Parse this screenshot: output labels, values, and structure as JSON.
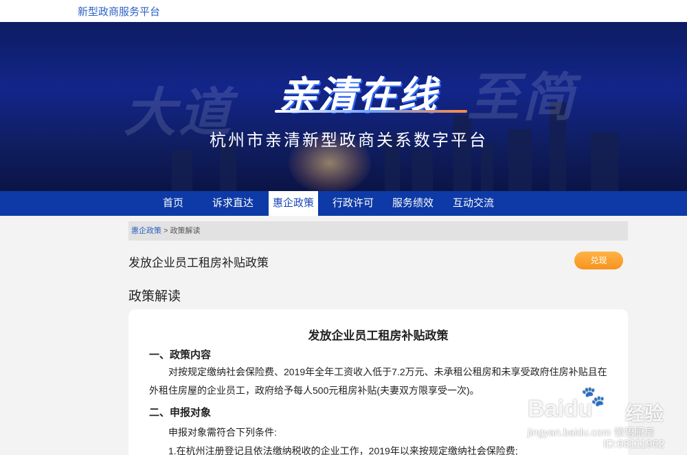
{
  "site": {
    "name": "新型政商服务平台"
  },
  "banner": {
    "ghost_left": "大道",
    "ghost_right": "至简",
    "logo": "亲清在线",
    "subtitle": "杭州市亲清新型政商关系数字平台"
  },
  "nav": {
    "items": [
      {
        "label": "首页"
      },
      {
        "label": "诉求直达"
      },
      {
        "label": "惠企政策"
      },
      {
        "label": "行政许可"
      },
      {
        "label": "服务绩效"
      },
      {
        "label": "互动交流"
      }
    ],
    "active_index": 2
  },
  "breadcrumb": {
    "link": "惠企政策",
    "separator": ">",
    "current": "政策解读"
  },
  "policy": {
    "title": "发放企业员工租房补贴政策",
    "redeem_button": "兑现"
  },
  "section": {
    "title": "政策解读"
  },
  "document": {
    "title": "发放企业员工租房补贴政策",
    "h1": "一、政策内容",
    "p1": "对按规定缴纳社会保险费、2019年全年工资收入低于7.2万元、未承租公租房和未享受政府住房补贴且在外租住房屋的企业员工，政府给予每人500元租房补贴(夫妻双方限享受一次)。",
    "h2": "二、申报对象",
    "p2": "申报对象需符合下列条件:",
    "p3": "1.在杭州注册登记且依法缴纳税收的企业工作，2019年以来按规定缴纳社会保险费;"
  },
  "watermark": {
    "brand": "Bai",
    "du": "du",
    "jingyan": "经验",
    "url": "jingyan.baidu.com",
    "author": "领悟厨房",
    "id": "ID:68111962"
  },
  "colors": {
    "nav_bg": "#0d3aa6",
    "accent_link": "#2d62c4",
    "button": "#f7931e"
  }
}
